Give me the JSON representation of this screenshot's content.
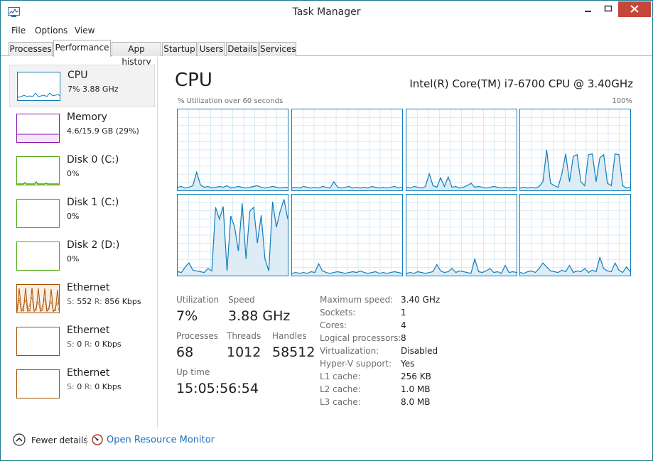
{
  "window": {
    "title": "Task Manager"
  },
  "menu": [
    "File",
    "Options",
    "View"
  ],
  "tabs": [
    "Processes",
    "Performance",
    "App history",
    "Startup",
    "Users",
    "Details",
    "Services"
  ],
  "active_tab": "Performance",
  "sidebar": [
    {
      "name": "CPU",
      "sub": "7% 3.88 GHz",
      "color": "#117dbb",
      "selected": true
    },
    {
      "name": "Memory",
      "sub": "4.6/15.9 GB (29%)",
      "color": "#8b12ae"
    },
    {
      "name": "Disk 0 (C:)",
      "sub": "0%",
      "color": "#4da60c"
    },
    {
      "name": "Disk 1 (C:)",
      "sub": "0%",
      "color": "#4da60c"
    },
    {
      "name": "Disk 2 (D:)",
      "sub": "0%",
      "color": "#4da60c"
    },
    {
      "name": "Ethernet",
      "s_label": "S:",
      "s_val": "552",
      "r_label": "R:",
      "r_val": "856 Kbps",
      "color": "#a74f01"
    },
    {
      "name": "Ethernet",
      "s_label": "S:",
      "s_val": "0",
      "r_label": "R:",
      "r_val": "0 Kbps",
      "color": "#a74f01"
    },
    {
      "name": "Ethernet",
      "s_label": "S:",
      "s_val": "0",
      "r_label": "R:",
      "r_val": "0 Kbps",
      "color": "#a74f01"
    }
  ],
  "main": {
    "title": "CPU",
    "model": "Intel(R) Core(TM) i7-6700 CPU @ 3.40GHz",
    "graph_label": "% Utilization over 60 seconds",
    "graph_max": "100%"
  },
  "stats": {
    "utilization": {
      "label": "Utilization",
      "value": "7%"
    },
    "speed": {
      "label": "Speed",
      "value": "3.88 GHz"
    },
    "processes": {
      "label": "Processes",
      "value": "68"
    },
    "threads": {
      "label": "Threads",
      "value": "1012"
    },
    "handles": {
      "label": "Handles",
      "value": "58512"
    },
    "uptime": {
      "label": "Up time",
      "value": "15:05:56:54"
    }
  },
  "details": [
    {
      "label": "Maximum speed:",
      "value": "3.40 GHz"
    },
    {
      "label": "Sockets:",
      "value": "1"
    },
    {
      "label": "Cores:",
      "value": "4"
    },
    {
      "label": "Logical processors:",
      "value": "8"
    },
    {
      "label": "Virtualization:",
      "value": "Disabled"
    },
    {
      "label": "Hyper-V support:",
      "value": "Yes"
    },
    {
      "label": "L1 cache:",
      "value": "256 KB"
    },
    {
      "label": "L2 cache:",
      "value": "1.0 MB"
    },
    {
      "label": "L3 cache:",
      "value": "8.0 MB"
    }
  ],
  "footer": {
    "fewer": "Fewer details",
    "monitor": "Open Resource Monitor"
  },
  "colors": {
    "cpu": "#117dbb",
    "cpu_fill": "#d9eaf4",
    "grid": "#d9eaf4",
    "close": "#c7463c",
    "link": "#1e6fb9"
  },
  "icons": [
    "task-manager-icon",
    "minimize-icon",
    "maximize-icon",
    "close-icon",
    "chevron-up-icon",
    "resource-monitor-icon"
  ],
  "chart_data": {
    "type": "area",
    "ylim": [
      0,
      100
    ],
    "series": [
      {
        "values": [
          3,
          4,
          2,
          3,
          5,
          22,
          6,
          3,
          4,
          2,
          3,
          4,
          3,
          5,
          2,
          3,
          4,
          3,
          2,
          3,
          4,
          5,
          3,
          2,
          3,
          4,
          3,
          2,
          3,
          3
        ]
      },
      {
        "values": [
          2,
          3,
          2,
          4,
          3,
          2,
          3,
          2,
          4,
          3,
          2,
          10,
          3,
          2,
          3,
          4,
          2,
          3,
          2,
          3,
          2,
          4,
          3,
          2,
          3,
          2,
          3,
          4,
          2,
          3
        ]
      },
      {
        "values": [
          3,
          2,
          4,
          3,
          2,
          4,
          20,
          5,
          3,
          15,
          4,
          16,
          3,
          4,
          2,
          3,
          5,
          8,
          3,
          4,
          3,
          2,
          3,
          4,
          3,
          2,
          3,
          2,
          3,
          2
        ]
      },
      {
        "values": [
          2,
          3,
          2,
          3,
          2,
          4,
          10,
          50,
          8,
          5,
          3,
          20,
          45,
          10,
          42,
          44,
          10,
          5,
          44,
          45,
          10,
          40,
          44,
          8,
          5,
          45,
          44,
          5,
          2,
          3
        ]
      },
      {
        "values": [
          4,
          3,
          10,
          15,
          6,
          5,
          4,
          3,
          8,
          5,
          85,
          70,
          86,
          5,
          74,
          60,
          30,
          90,
          20,
          80,
          85,
          40,
          75,
          20,
          5,
          92,
          60,
          80,
          95,
          70
        ]
      },
      {
        "values": [
          2,
          3,
          2,
          3,
          2,
          4,
          3,
          14,
          5,
          3,
          2,
          3,
          4,
          3,
          2,
          3,
          4,
          3,
          5,
          3,
          2,
          3,
          4,
          2,
          3,
          2,
          3,
          4,
          3,
          2
        ]
      },
      {
        "values": [
          2,
          3,
          2,
          4,
          3,
          2,
          3,
          4,
          13,
          5,
          3,
          4,
          8,
          3,
          5,
          4,
          3,
          2,
          20,
          4,
          3,
          5,
          8,
          3,
          4,
          2,
          12,
          3,
          4,
          3
        ]
      },
      {
        "values": [
          3,
          2,
          4,
          5,
          3,
          8,
          15,
          10,
          5,
          4,
          3,
          6,
          4,
          12,
          3,
          5,
          4,
          8,
          3,
          6,
          4,
          22,
          8,
          5,
          4,
          15,
          6,
          3,
          10,
          4
        ]
      }
    ]
  }
}
